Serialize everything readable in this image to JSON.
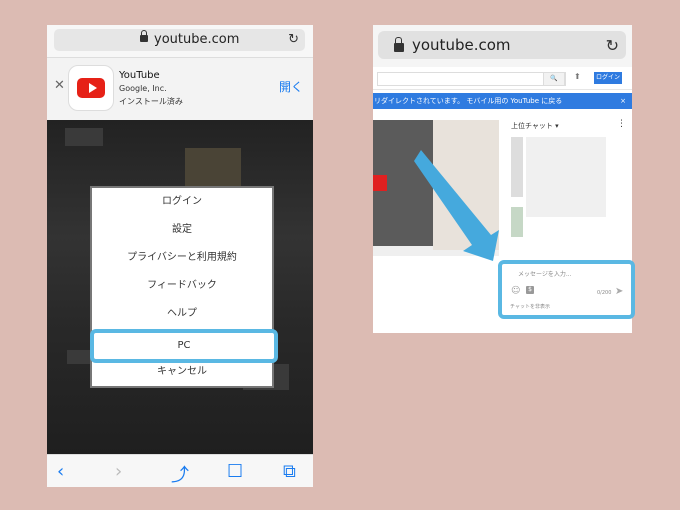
{
  "left_phone": {
    "url": "youtube.com",
    "app_banner": {
      "title": "YouTube",
      "developer": "Google, Inc.",
      "status": "インストール済み",
      "open_label": "開く"
    },
    "menu_items": [
      "ログイン",
      "設定",
      "プライバシーと利用規約",
      "フィードバック",
      "ヘルプ",
      "PC",
      "キャンセル"
    ]
  },
  "right_screenshot": {
    "url": "youtube.com",
    "header": {
      "login_label": "ログイン"
    },
    "banner": {
      "text_prefix": "リダイレクトされています。",
      "text_link": "モバイル用の YouTube に戻る",
      "close_label": "×"
    },
    "chat": {
      "header": "上位チャット ▾",
      "input_placeholder": "メッセージを入力...",
      "char_count": "0/200",
      "caption": "チャットを非表示"
    }
  },
  "colors": {
    "background": "#dcbbb3",
    "highlight": "#5ab8e3",
    "accent_blue": "#2f7be0",
    "youtube_red": "#e62117"
  }
}
